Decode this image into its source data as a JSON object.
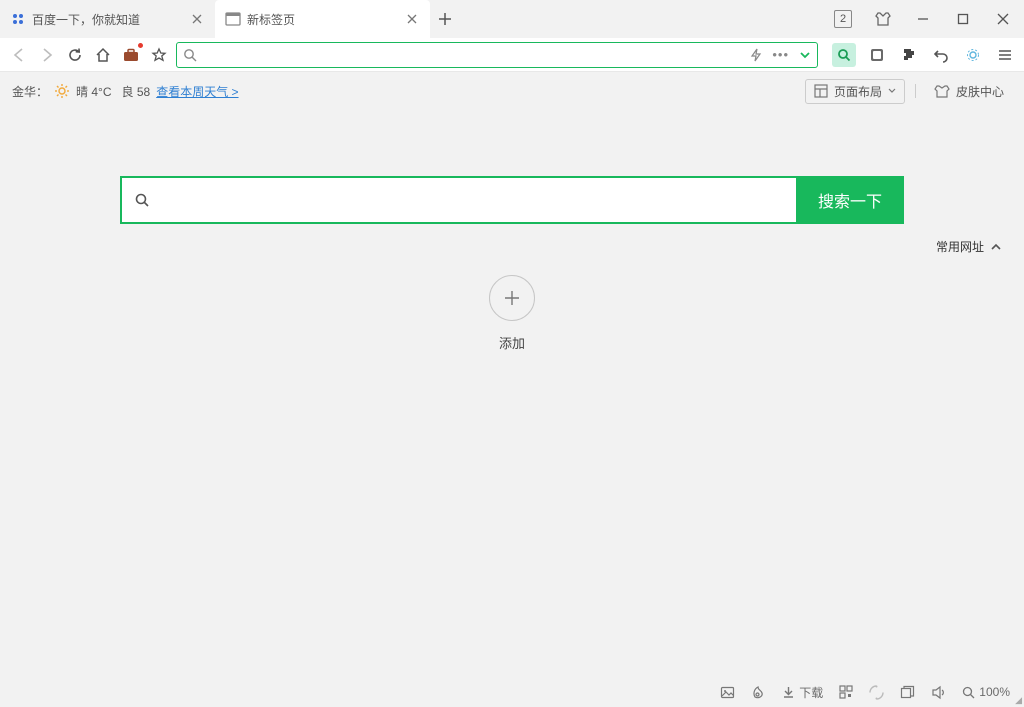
{
  "titlebar": {
    "tabs": [
      {
        "title": "百度一下，你就知道",
        "favicon": "baidu"
      },
      {
        "title": "新标签页",
        "favicon": "newtab"
      }
    ],
    "counter": "2"
  },
  "addressbar": {
    "value": ""
  },
  "infobar": {
    "city": "金华：",
    "weather": "晴 4°C",
    "air_quality": "良 58",
    "weather_link": "查看本周天气 >",
    "layout_btn": "页面布局",
    "skin_btn": "皮肤中心"
  },
  "search": {
    "placeholder": "",
    "button": "搜索一下"
  },
  "quick": {
    "heading": "常用网址"
  },
  "addtile": {
    "label": "添加"
  },
  "statusbar": {
    "download": "下载",
    "zoom": "100%"
  }
}
